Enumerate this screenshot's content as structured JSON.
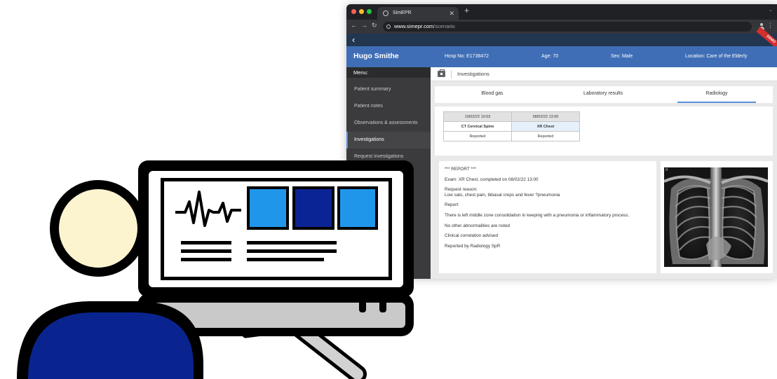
{
  "browser": {
    "tab_title": "SimEPR",
    "url_domain": "www.simepr.com",
    "url_path": "/scenario"
  },
  "app": {
    "back_icon": "chevron-left-icon",
    "demo_badge": "DEMO"
  },
  "patient": {
    "name": "Hugo Smithe",
    "hosp_no": "Hosp No: E1738472",
    "age": "Age: 70",
    "sex": "Sex: Male",
    "location": "Location: Care of the Elderly"
  },
  "sidebar": {
    "menu_label": "Menu:",
    "items": [
      {
        "label": "Patient summary"
      },
      {
        "label": "Patient notes"
      },
      {
        "label": "Observations & assessments"
      },
      {
        "label": "Investigations"
      },
      {
        "label": "Request investigations"
      }
    ]
  },
  "content": {
    "breadcrumb_icon": "briefcase-icon",
    "breadcrumb": "Investigations",
    "tabs": [
      {
        "label": "Blood gas"
      },
      {
        "label": "Laboratory results"
      },
      {
        "label": "Radiology"
      }
    ],
    "studies": [
      {
        "date": "10/02/22 10:03",
        "exam": "CT Cervical Spine",
        "status": "Reported"
      },
      {
        "date": "08/02/22 13:00",
        "exam": "XR Chest",
        "status": "Reported"
      }
    ],
    "report": {
      "header": "*** REPORT ***",
      "exam": "Exam: XR Chest, completed on 08/02/22 13:00",
      "reason_label": "Request reason:",
      "reason": "Low sats, chest pain, bibasal creps and fever ?pneumonia",
      "report_label": "Report:",
      "finding": "There is left middle zone consolidation in keeping with a pneumonia or inflammatory process.",
      "other": "No other abnormalities are noted",
      "advice": "Clinical correlation advised",
      "reported_by": "Reported by Radiology SpR"
    },
    "xray_marker": "R"
  },
  "illustration": {
    "monitor_icon": "heartbeat-icon",
    "colors": {
      "light_blue": "#1f96ea",
      "dark_blue": "#0b2495",
      "figure_blue": "#0a248f",
      "skin": "#fcf3cf"
    }
  }
}
